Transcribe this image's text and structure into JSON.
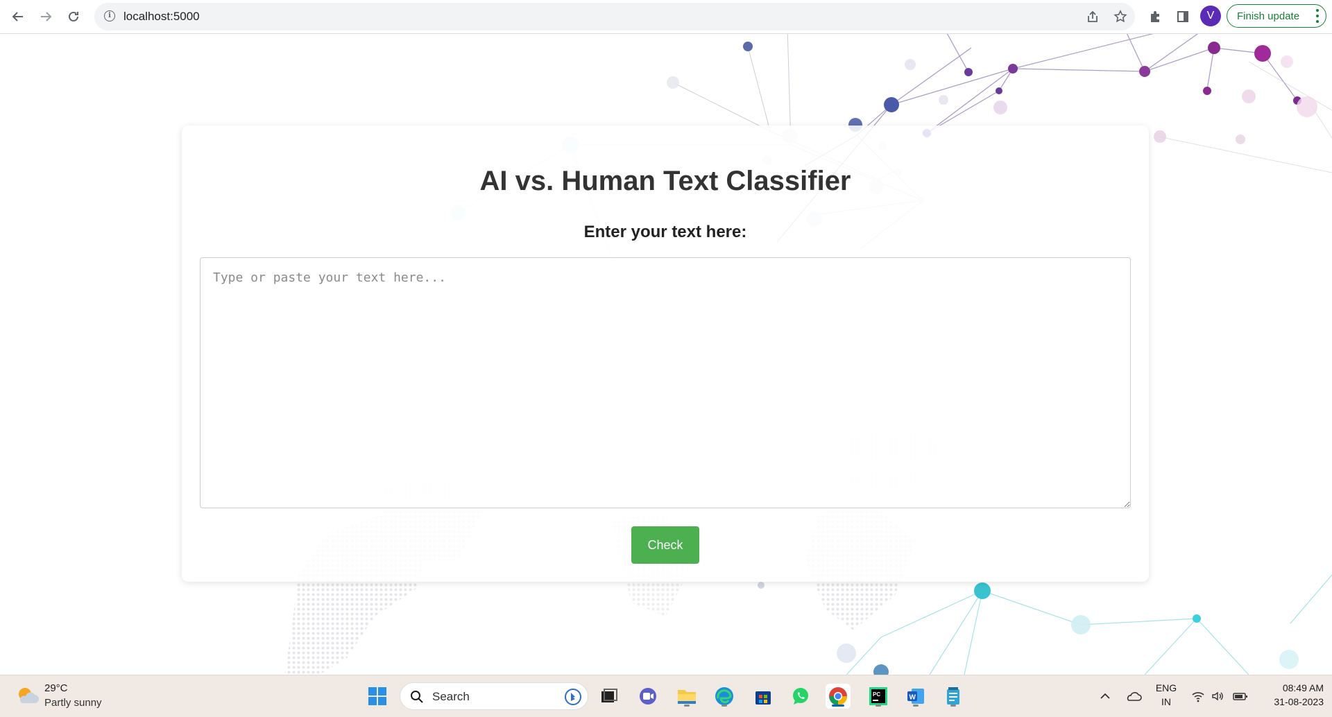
{
  "browser": {
    "url": "localhost:5000",
    "finish_update_label": "Finish update",
    "profile_initial": "V"
  },
  "main": {
    "title": "AI vs. Human Text Classifier",
    "input_label": "Enter your text here:",
    "textarea_placeholder": "Type or paste your text here...",
    "textarea_value": "",
    "check_button_label": "Check"
  },
  "taskbar": {
    "weather_temp": "29°C",
    "weather_desc": "Partly sunny",
    "search_label": "Search",
    "language_top": "ENG",
    "language_bottom": "IN",
    "time": "08:49 AM",
    "date": "31-08-2023",
    "apps": [
      "start-icon",
      "search",
      "file-explorer-terminal-icon",
      "teams-icon",
      "folder-icon",
      "edge-icon",
      "store-icon",
      "whatsapp-icon",
      "chrome-icon",
      "pycharm-icon",
      "word-icon",
      "notepad-icon"
    ]
  },
  "colors": {
    "accent_button": "#4caf50",
    "title_text": "#333333",
    "update_green": "#188038",
    "avatar": "#5b2bb5"
  }
}
